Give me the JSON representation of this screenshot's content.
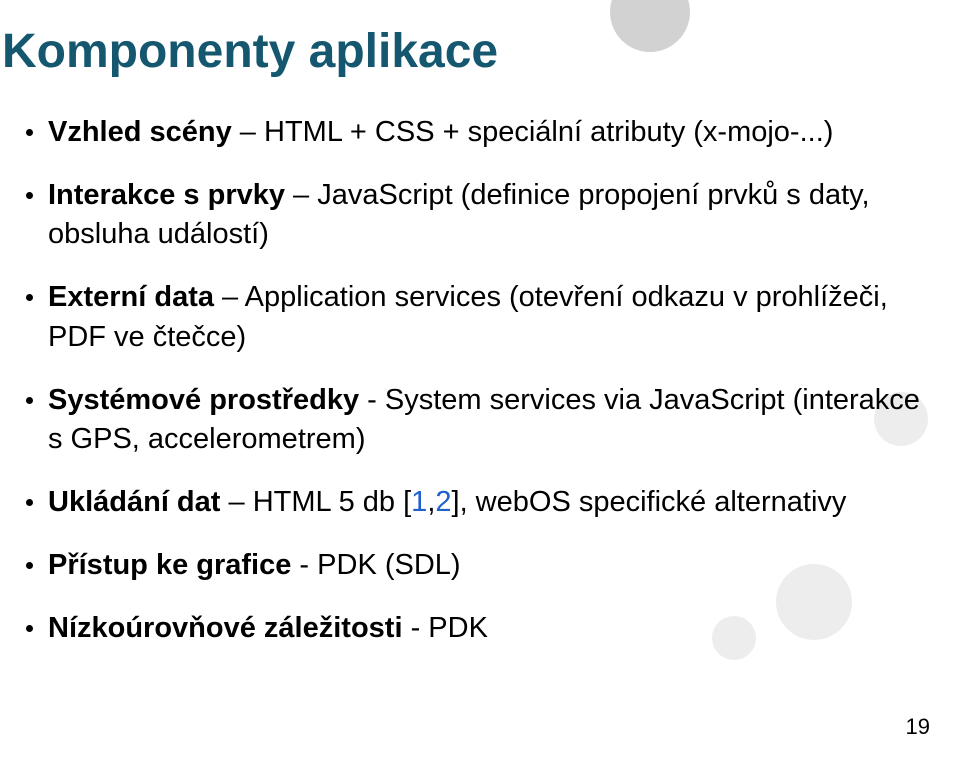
{
  "title": "Komponenty aplikace",
  "bullets": [
    {
      "lead": "Vzhled scény",
      "sep": " – ",
      "rest_a": "HTML + CSS + speciální atributy (x-mojo-...)"
    },
    {
      "lead": "Interakce s prvky",
      "sep": " – ",
      "rest_a": "JavaScript (definice propojení prvků s daty, obsluha událostí)"
    },
    {
      "lead": "Externí data",
      "sep": " – ",
      "rest_a": "Application services (otevření odkazu v prohlížeči, PDF ve čtečce)"
    },
    {
      "lead": "Systémové prostředky",
      "sep": " - ",
      "rest_a": "System services via JavaScript (interakce s GPS, accelerometrem)"
    },
    {
      "lead": "Ukládání dat",
      "sep": " – ",
      "rest_a": "HTML 5 db [",
      "link1": "1",
      "mid": ",",
      "link2": "2",
      "rest_b": "], webOS specifické alternativy"
    },
    {
      "lead": "Přístup ke grafice",
      "sep": " - ",
      "rest_a": "PDK (SDL)"
    },
    {
      "lead": "Nízkoúrovňové záležitosti",
      "sep": " - ",
      "rest_a": "PDK"
    }
  ],
  "page_number": "19"
}
